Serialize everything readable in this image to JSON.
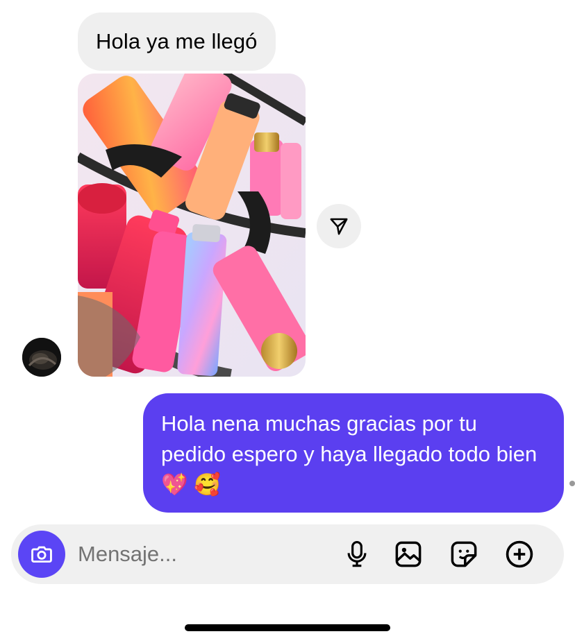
{
  "thread": {
    "incoming_text": "Hola ya me llegó",
    "outgoing_text": "Hola nena muchas gracias por tu pedido espero y haya llegado todo bien 💖 🥰"
  },
  "composer": {
    "placeholder": "Mensaje..."
  },
  "icons": {
    "avatar": "contact-avatar",
    "share": "send-paper-plane-icon",
    "camera": "camera-icon",
    "mic": "microphone-icon",
    "gallery": "image-gallery-icon",
    "sticker": "sticker-icon",
    "plus": "plus-circle-icon"
  },
  "colors": {
    "outgoing_bubble": "#5b3ff0",
    "incoming_bubble": "#efefef",
    "camera_button": "#5b45f5",
    "composer_bg": "#f0f0f0"
  }
}
